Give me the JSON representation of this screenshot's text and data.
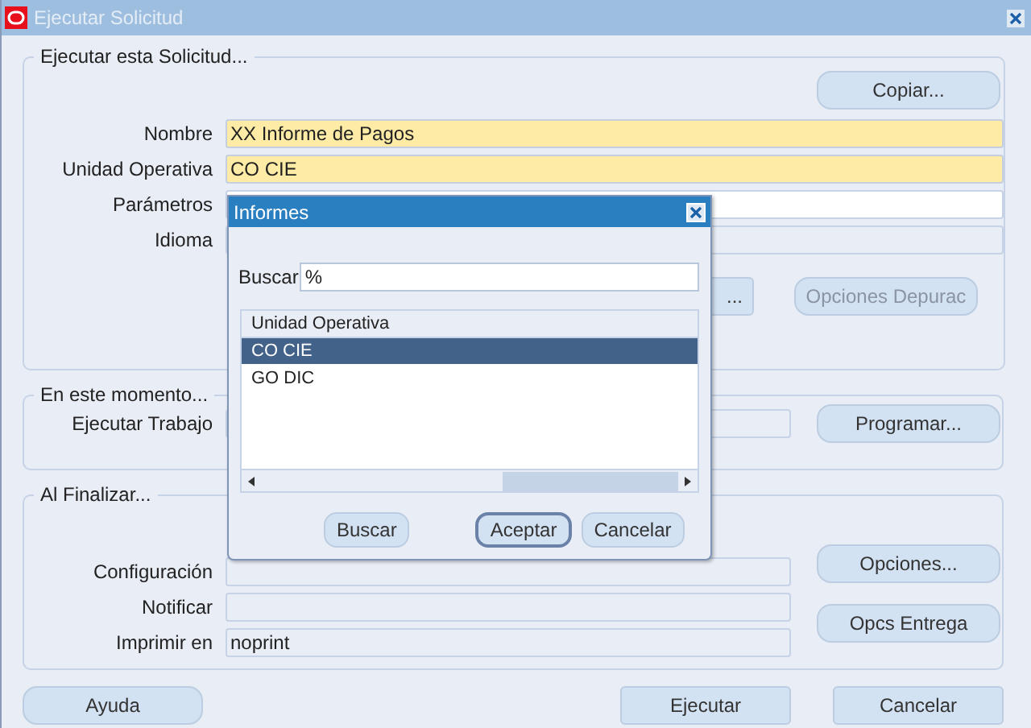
{
  "window": {
    "title": "Ejecutar Solicitud"
  },
  "request_group": {
    "legend": "Ejecutar esta Solicitud...",
    "copy_button": "Copiar...",
    "fields": [
      {
        "label": "Nombre",
        "value": "XX Informe de Pagos",
        "required": true
      },
      {
        "label": "Unidad Operativa",
        "value": "CO CIE",
        "required": true
      },
      {
        "label": "Parámetros",
        "required": false
      },
      {
        "label": "Idioma",
        "required": false,
        "disabled": true
      }
    ],
    "partial_button": "...",
    "debug_button": {
      "label": "Opciones Depurac",
      "disabled": true
    }
  },
  "schedule_group": {
    "legend": "En este momento...",
    "label": "Ejecutar Trabajo",
    "button": "Programar..."
  },
  "completion_group": {
    "legend": "Al Finalizar...",
    "fields": [
      {
        "label": "Configuración"
      },
      {
        "label": "Notificar"
      },
      {
        "label": "Imprimir en",
        "value": "noprint"
      }
    ],
    "options_button": "Opciones...",
    "delivery_button": "Opcs Entrega"
  },
  "help_button": "Ayuda",
  "footer_buttons": [
    "Ejecutar",
    "Cancelar"
  ],
  "dialog": {
    "title": "Informes",
    "search_label": "Buscar",
    "search_value": "%",
    "column": "Unidad Operativa",
    "rows": [
      {
        "text": "CO CIE",
        "selected": true
      },
      {
        "text": "GO DIC",
        "selected": false
      }
    ],
    "buttons": [
      {
        "label": "Buscar",
        "default": false
      },
      {
        "label": "Aceptar",
        "default": true
      },
      {
        "label": "Cancelar",
        "default": false
      }
    ]
  }
}
